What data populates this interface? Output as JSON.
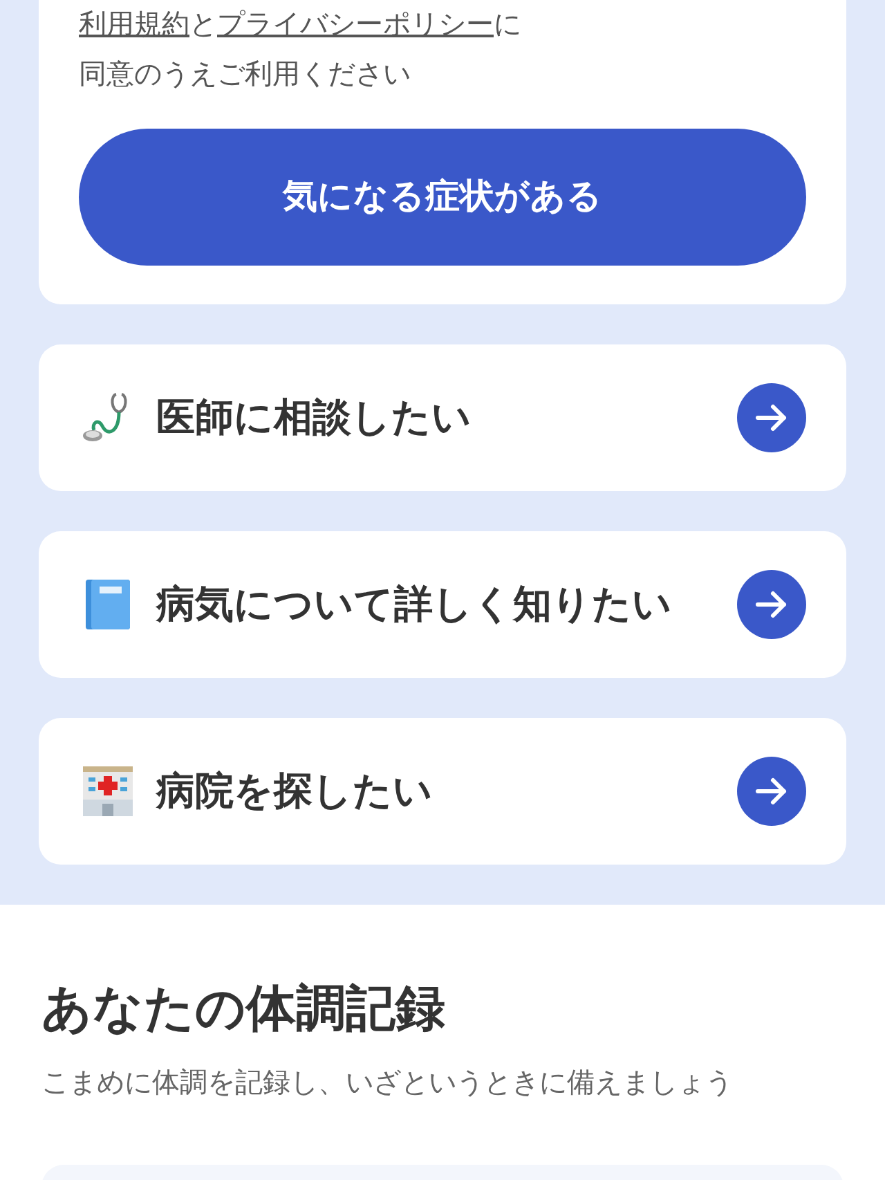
{
  "consent": {
    "terms_link": "利用規約",
    "connector": "と",
    "privacy_link": "プライバシーポリシー",
    "suffix": "に",
    "line_2": "同意のうえご利用ください"
  },
  "primary_button": "気になる症状がある",
  "menu": [
    {
      "kind": "doctor",
      "label": "医師に相談したい"
    },
    {
      "kind": "book",
      "label": "病気について詳しく知りたい"
    },
    {
      "kind": "hospital",
      "label": "病院を探したい"
    }
  ],
  "record": {
    "title": "あなたの体調記録",
    "subtitle": "こまめに体調を記録し、いざというときに備えましょう"
  }
}
